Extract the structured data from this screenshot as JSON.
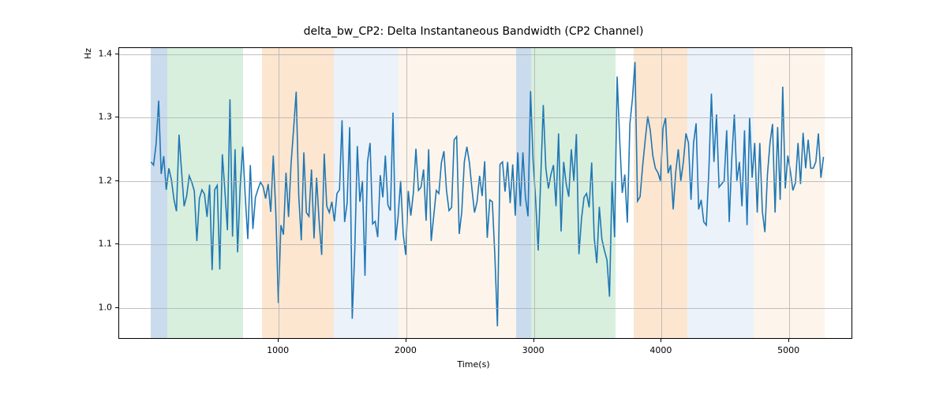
{
  "chart_data": {
    "type": "line",
    "title": "delta_bw_CP2: Delta Instantaneous Bandwidth (CP2 Channel)",
    "xlabel": "Time(s)",
    "ylabel": "Hz",
    "xlim": [
      -250,
      5500
    ],
    "ylim": [
      0.95,
      1.41
    ],
    "xticks": [
      1000,
      2000,
      3000,
      4000,
      5000
    ],
    "yticks": [
      1.0,
      1.1,
      1.2,
      1.3,
      1.4
    ],
    "xtick_labels": [
      "1000",
      "2000",
      "3000",
      "4000",
      "5000"
    ],
    "ytick_labels": [
      "1.0",
      "1.1",
      "1.2",
      "1.3",
      "1.4"
    ],
    "grid": true,
    "line_color": "#1f77b4",
    "background_bands": [
      {
        "x0": 0,
        "x1": 130,
        "color": "#6699cc"
      },
      {
        "x0": 130,
        "x1": 720,
        "color": "#8fd19e"
      },
      {
        "x0": 870,
        "x1": 1430,
        "color": "#f5b879"
      },
      {
        "x0": 1430,
        "x1": 1940,
        "color": "#c9daf0"
      },
      {
        "x0": 1940,
        "x1": 2860,
        "color": "#f9e1c6"
      },
      {
        "x0": 2860,
        "x1": 2980,
        "color": "#6699cc"
      },
      {
        "x0": 2980,
        "x1": 3640,
        "color": "#8fd19e"
      },
      {
        "x0": 3780,
        "x1": 4200,
        "color": "#f5b879"
      },
      {
        "x0": 4200,
        "x1": 4720,
        "color": "#c9daf0"
      },
      {
        "x0": 4720,
        "x1": 5280,
        "color": "#f9e1c6"
      }
    ],
    "series": [
      {
        "name": "delta_bw_CP2",
        "x_start": 0,
        "x_step": 20,
        "y": [
          1.23,
          1.225,
          1.258,
          1.327,
          1.211,
          1.239,
          1.186,
          1.22,
          1.202,
          1.171,
          1.152,
          1.273,
          1.215,
          1.16,
          1.176,
          1.208,
          1.198,
          1.184,
          1.105,
          1.172,
          1.186,
          1.179,
          1.143,
          1.194,
          1.059,
          1.186,
          1.193,
          1.06,
          1.242,
          1.185,
          1.122,
          1.329,
          1.112,
          1.25,
          1.087,
          1.19,
          1.254,
          1.175,
          1.108,
          1.225,
          1.124,
          1.174,
          1.187,
          1.198,
          1.191,
          1.172,
          1.195,
          1.151,
          1.24,
          1.15,
          1.007,
          1.13,
          1.115,
          1.213,
          1.143,
          1.228,
          1.283,
          1.341,
          1.177,
          1.106,
          1.245,
          1.15,
          1.144,
          1.218,
          1.109,
          1.205,
          1.136,
          1.083,
          1.243,
          1.16,
          1.15,
          1.167,
          1.136,
          1.18,
          1.186,
          1.296,
          1.135,
          1.165,
          1.285,
          0.982,
          1.09,
          1.255,
          1.167,
          1.2,
          1.05,
          1.23,
          1.26,
          1.132,
          1.136,
          1.111,
          1.209,
          1.174,
          1.24,
          1.162,
          1.153,
          1.308,
          1.106,
          1.143,
          1.2,
          1.116,
          1.083,
          1.184,
          1.145,
          1.181,
          1.251,
          1.185,
          1.19,
          1.218,
          1.137,
          1.25,
          1.105,
          1.145,
          1.185,
          1.18,
          1.229,
          1.247,
          1.185,
          1.153,
          1.158,
          1.265,
          1.27,
          1.116,
          1.151,
          1.23,
          1.254,
          1.229,
          1.187,
          1.15,
          1.167,
          1.208,
          1.176,
          1.231,
          1.11,
          1.17,
          1.167,
          1.081,
          0.97,
          1.226,
          1.23,
          1.183,
          1.23,
          1.165,
          1.226,
          1.145,
          1.245,
          1.16,
          1.245,
          1.174,
          1.144,
          1.342,
          1.232,
          1.17,
          1.09,
          1.204,
          1.32,
          1.22,
          1.188,
          1.21,
          1.225,
          1.16,
          1.275,
          1.12,
          1.23,
          1.195,
          1.175,
          1.25,
          1.2,
          1.274,
          1.084,
          1.14,
          1.174,
          1.18,
          1.158,
          1.229,
          1.11,
          1.07,
          1.159,
          1.108,
          1.09,
          1.075,
          1.017,
          1.2,
          1.111,
          1.365,
          1.264,
          1.181,
          1.21,
          1.134,
          1.29,
          1.33,
          1.388,
          1.168,
          1.175,
          1.223,
          1.264,
          1.302,
          1.28,
          1.24,
          1.22,
          1.213,
          1.2,
          1.283,
          1.3,
          1.212,
          1.225,
          1.155,
          1.214,
          1.25,
          1.2,
          1.23,
          1.275,
          1.26,
          1.17,
          1.26,
          1.291,
          1.155,
          1.17,
          1.135,
          1.13,
          1.215,
          1.338,
          1.23,
          1.305,
          1.19,
          1.195,
          1.2,
          1.28,
          1.135,
          1.235,
          1.305,
          1.2,
          1.23,
          1.16,
          1.28,
          1.13,
          1.3,
          1.205,
          1.26,
          1.15,
          1.26,
          1.152,
          1.119,
          1.21,
          1.26,
          1.29,
          1.15,
          1.285,
          1.17,
          1.349,
          1.188,
          1.24,
          1.215,
          1.185,
          1.197,
          1.26,
          1.195,
          1.276,
          1.22,
          1.265,
          1.22,
          1.22,
          1.23,
          1.275,
          1.205,
          1.238
        ]
      }
    ]
  },
  "layout": {
    "fig_w": 1200,
    "fig_h": 500,
    "ax_left": 150,
    "ax_top": 60,
    "ax_width": 930,
    "ax_height": 370
  }
}
